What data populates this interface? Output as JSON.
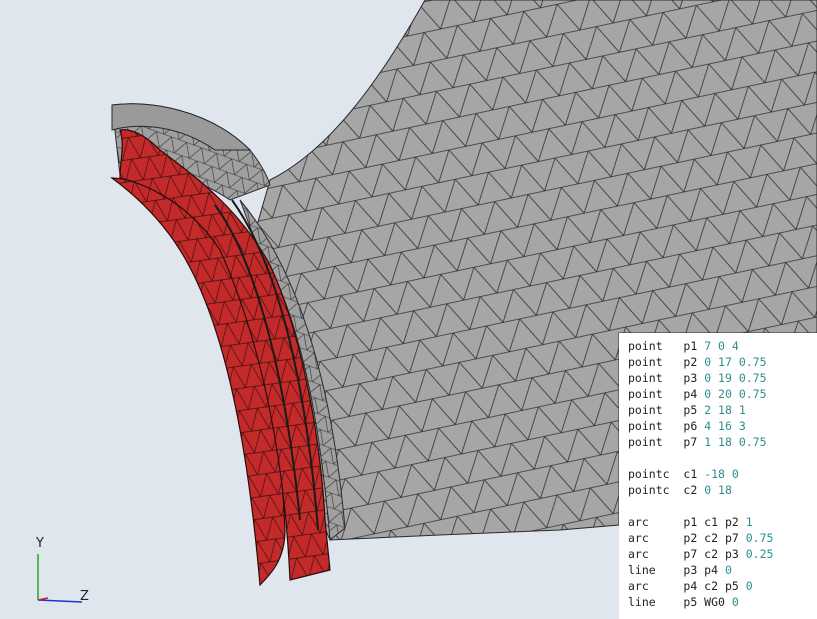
{
  "scene": {
    "background": "#dfe6ee",
    "mesh_color": "#a6a6a6",
    "highlight_color": "#c42a2a",
    "edge_color": "#2a2a2a"
  },
  "axes": {
    "y_label": "Y",
    "z_label": "Z",
    "y_color": "#22aa22",
    "z_color": "#2233cc"
  },
  "code_lines": [
    {
      "cmd": "point",
      "args": "p1",
      "nums": "7 0 4"
    },
    {
      "cmd": "point",
      "args": "p2",
      "nums": "0 17 0.75"
    },
    {
      "cmd": "point",
      "args": "p3",
      "nums": "0 19 0.75"
    },
    {
      "cmd": "point",
      "args": "p4",
      "nums": "0 20 0.75"
    },
    {
      "cmd": "point",
      "args": "p5",
      "nums": "2 18 1"
    },
    {
      "cmd": "point",
      "args": "p6",
      "nums": "4 16 3"
    },
    {
      "cmd": "point",
      "args": "p7",
      "nums": "1 18 0.75"
    },
    null,
    {
      "cmd": "pointc",
      "args": "c1",
      "nums": "-18 0"
    },
    {
      "cmd": "pointc",
      "args": "c2",
      "nums": "0 18"
    },
    null,
    {
      "cmd": "arc",
      "args": "p1 c1 p2",
      "nums": "1"
    },
    {
      "cmd": "arc",
      "args": "p2 c2 p7",
      "nums": "0.75"
    },
    {
      "cmd": "arc",
      "args": "p7 c2 p3",
      "nums": "0.25"
    },
    {
      "cmd": "line",
      "args": "p3 p4",
      "nums": "0"
    },
    {
      "cmd": "arc",
      "args": "p4 c2 p5",
      "nums": "0"
    },
    {
      "cmd": "line",
      "args": "p5 WG0",
      "nums": "0"
    }
  ]
}
